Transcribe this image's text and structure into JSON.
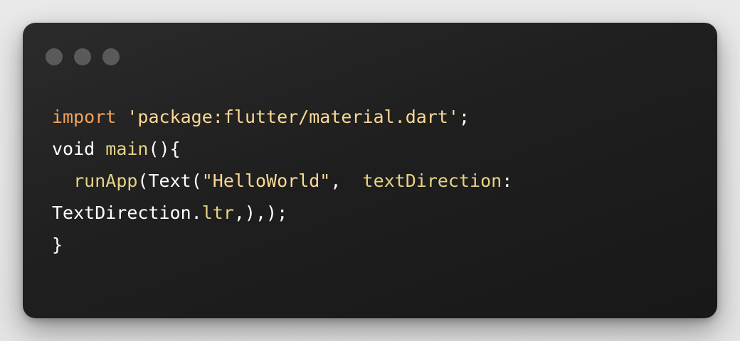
{
  "window": {
    "controls": [
      "close",
      "minimize",
      "maximize"
    ],
    "control_color": "#5a5a5a",
    "background": "#1f1f1f"
  },
  "code": {
    "language": "dart",
    "line1": {
      "keyword": "import",
      "space": " ",
      "string": "'package:flutter/material.dart'",
      "end": ";"
    },
    "line2": {
      "type": "void",
      "space": " ",
      "function": "main",
      "rest": "(){"
    },
    "line3": {
      "indent": "  ",
      "function": "runApp",
      "open": "(Text(",
      "string": "\"HelloWorld\"",
      "comma": ",  ",
      "param": "textDirection",
      "colon": ":"
    },
    "line4": {
      "object": "TextDirection.",
      "property": "ltr",
      "end": ",),);"
    },
    "line5": {
      "brace": "}"
    }
  },
  "colors": {
    "keyword": "#f3a35c",
    "string": "#fbd994",
    "function": "#e6d383",
    "text": "#ffffff"
  }
}
